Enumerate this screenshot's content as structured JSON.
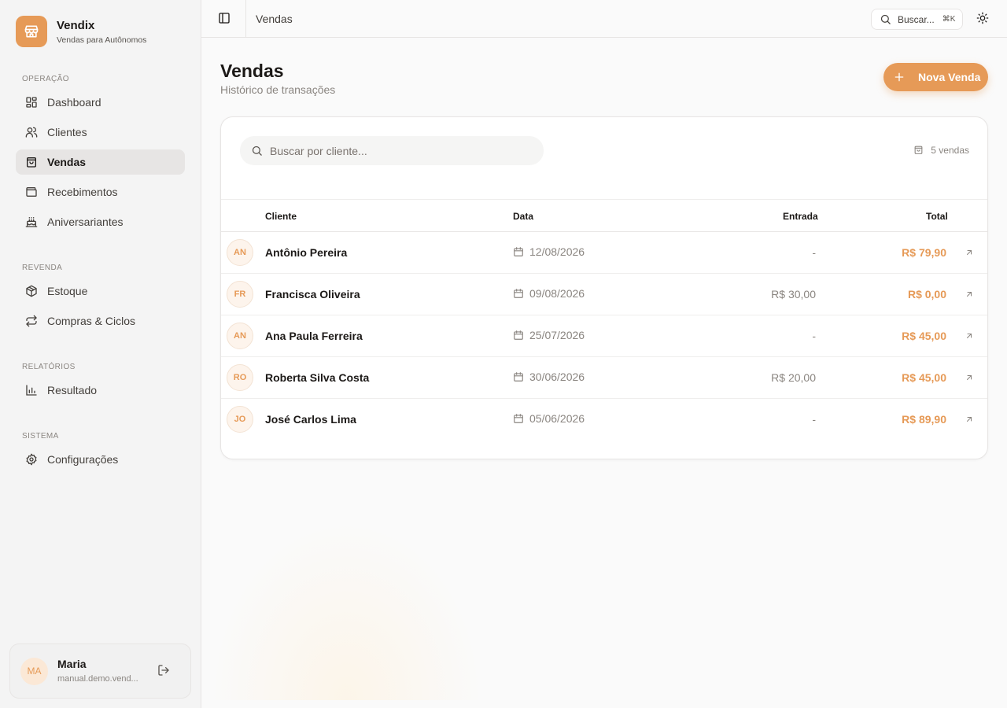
{
  "app": {
    "name": "Vendix",
    "tagline": "Vendas para Autônomos"
  },
  "sidebar": {
    "sections": [
      {
        "heading": "OPERAÇÃO",
        "items": [
          {
            "label": "Dashboard",
            "icon": "grid-icon"
          },
          {
            "label": "Clientes",
            "icon": "users-icon"
          },
          {
            "label": "Vendas",
            "icon": "shopping-bag-icon",
            "active": true
          },
          {
            "label": "Recebimentos",
            "icon": "wallet-icon"
          },
          {
            "label": "Aniversariantes",
            "icon": "cake-icon"
          }
        ]
      },
      {
        "heading": "REVENDA",
        "items": [
          {
            "label": "Estoque",
            "icon": "box-icon"
          },
          {
            "label": "Compras & Ciclos",
            "icon": "repeat-icon"
          }
        ]
      },
      {
        "heading": "RELATÓRIOS",
        "items": [
          {
            "label": "Resultado",
            "icon": "bar-chart-icon"
          }
        ]
      },
      {
        "heading": "SISTEMA",
        "items": [
          {
            "label": "Configurações",
            "icon": "gear-icon"
          }
        ]
      }
    ]
  },
  "user": {
    "initials": "MA",
    "name": "Maria",
    "email": "manual.demo.vend..."
  },
  "topbar": {
    "title": "Vendas",
    "search_label": "Buscar...",
    "search_shortcut": "⌘K"
  },
  "page": {
    "title": "Vendas",
    "subtitle": "Histórico de transações",
    "new_button": "Nova Venda",
    "search_placeholder": "Buscar por cliente...",
    "count_label": "5 vendas"
  },
  "table": {
    "columns": {
      "cliente": "Cliente",
      "data": "Data",
      "entrada": "Entrada",
      "total": "Total"
    },
    "rows": [
      {
        "initials": "AN",
        "cliente": "Antônio Pereira",
        "data": "12/08/2026",
        "entrada": "-",
        "total": "R$ 79,90"
      },
      {
        "initials": "FR",
        "cliente": "Francisca Oliveira",
        "data": "09/08/2026",
        "entrada": "R$ 30,00",
        "total": "R$ 0,00"
      },
      {
        "initials": "AN",
        "cliente": "Ana Paula Ferreira",
        "data": "25/07/2026",
        "entrada": "-",
        "total": "R$ 45,00"
      },
      {
        "initials": "RO",
        "cliente": "Roberta Silva Costa",
        "data": "30/06/2026",
        "entrada": "R$ 20,00",
        "total": "R$ 45,00"
      },
      {
        "initials": "JO",
        "cliente": "José Carlos Lima",
        "data": "05/06/2026",
        "entrada": "-",
        "total": "R$ 89,90"
      }
    ]
  },
  "colors": {
    "accent": "#e69a57",
    "active_bg": "#e7e5e4",
    "muted": "#8a8580"
  }
}
